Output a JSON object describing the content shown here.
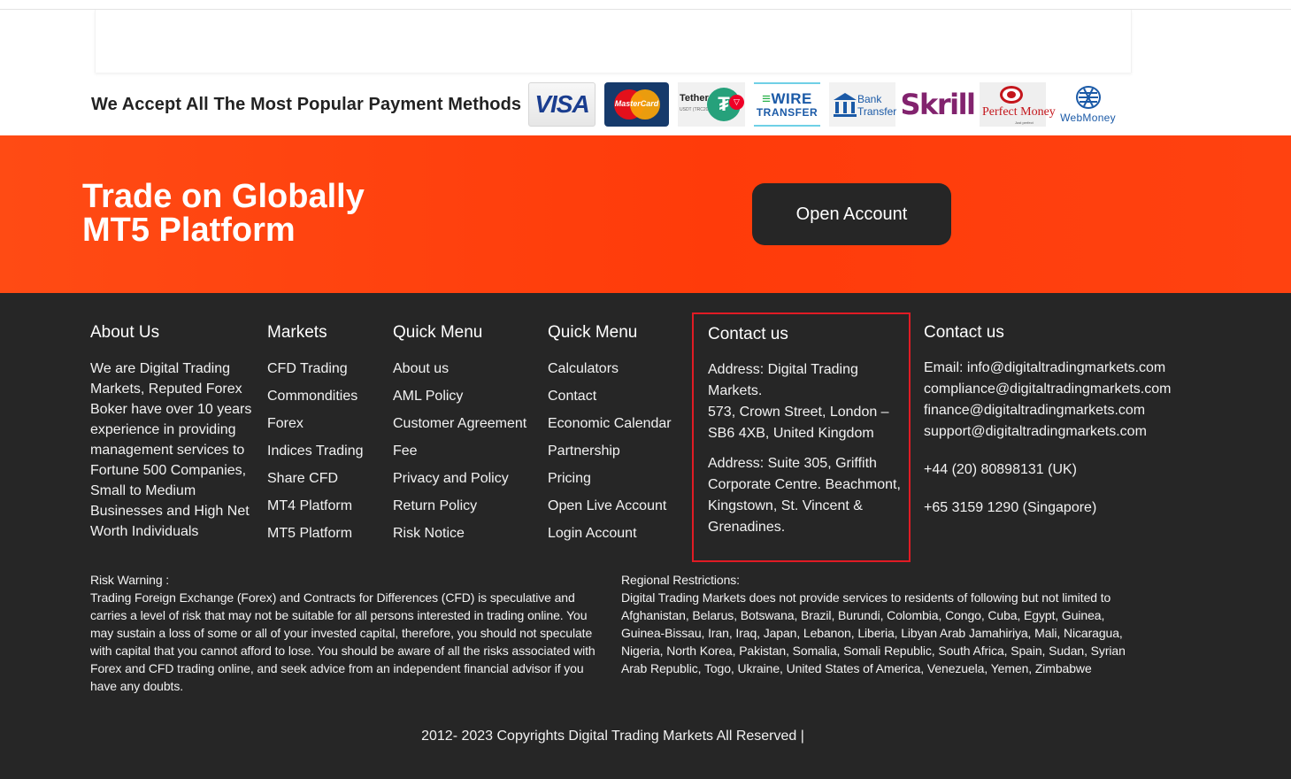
{
  "payments": {
    "title": "We Accept All The Most Popular Payment Methods",
    "logos": {
      "visa": "VISA",
      "mastercard": "MasterCard",
      "tether": "Tether",
      "tether_sub": "USDT (TRC20)",
      "wire_top": "WIRE",
      "wire_bottom": "TRANSFER",
      "bank_line1": "Bank",
      "bank_line2": "Transfer",
      "skrill": "Skrill",
      "perfect_money": "Perfect Money",
      "perfect_money_sub": "Just perfect",
      "webmoney": "WebMoney"
    }
  },
  "banner": {
    "title_line1": "Trade on Globally",
    "title_line2": "MT5 Platform",
    "button_label": "Open Account"
  },
  "footer": {
    "about": {
      "heading": "About Us",
      "text": "We are Digital Trading Markets, Reputed Forex Boker have over 10 years experience in providing management services to Fortune 500 Companies, Small to Medium Businesses and High Net Worth Individuals"
    },
    "markets": {
      "heading": "Markets",
      "items": [
        "CFD Trading",
        "Commondities",
        "Forex",
        "Indices Trading",
        "Share CFD",
        "MT4 Platform",
        "MT5 Platform"
      ]
    },
    "quick_menu_1": {
      "heading": "Quick Menu",
      "items": [
        "About us",
        "AML Policy",
        "Customer Agreement",
        "Fee",
        "Privacy and Policy",
        "Return Policy",
        "Risk Notice"
      ]
    },
    "quick_menu_2": {
      "heading": "Quick Menu",
      "items": [
        "Calculators",
        "Contact",
        "Economic Calendar",
        "Partnership",
        "Pricing",
        "Open Live Account",
        "Login Account"
      ]
    },
    "contact_1": {
      "heading": "Contact us",
      "address1": "Address: Digital Trading Markets.",
      "address1_line2": "573, Crown Street, London – SB6 4XB, United Kingdom",
      "address2": "Address: Suite 305, Griffith Corporate Centre. Beachmont, Kingstown, St. Vincent & Grenadines."
    },
    "contact_2": {
      "heading": "Contact us",
      "emails": [
        "Email: info@digitaltradingmarkets.com",
        "compliance@digitaltradingmarkets.com",
        "finance@digitaltradingmarkets.com",
        "support@digitaltradingmarkets.com"
      ],
      "phone_uk": "+44 (20) 80898131 (UK)",
      "phone_sg": "+65 3159 1290 (Singapore)"
    },
    "risk": {
      "heading": "Risk Warning :",
      "text": "Trading Foreign Exchange (Forex) and Contracts for Differences (CFD) is speculative and carries a level of risk that may not be suitable for all persons interested in trading online. You may sustain a loss of some or all of your invested capital, therefore, you should not speculate with capital that you cannot afford to lose. You should be aware of all the risks associated with Forex and CFD trading online, and seek advice from an independent financial advisor if you have any doubts."
    },
    "regional": {
      "heading": "Regional Restrictions:",
      "text": "Digital Trading Markets does not provide services to residents of following but not limited to Afghanistan, Belarus, Botswana, Brazil, Burundi, Colombia, Congo, Cuba, Egypt, Guinea, Guinea-Bissau, Iran, Iraq, Japan, Lebanon, Liberia, Libyan Arab Jamahiriya, Mali, Nicaragua, Nigeria, North Korea, Pakistan, Somalia, Somali Republic, South Africa, Spain, Sudan, Syrian Arab Republic, Togo, Ukraine, United States of America, Venezuela, Yemen, Zimbabwe"
    },
    "copyright": "2012- 2023 Copyrights Digital Trading Markets All Reserved |"
  },
  "colors": {
    "banner": "#ff4210",
    "footer_bg": "#262626",
    "button_bg": "#262626",
    "highlight_border": "#e01b24"
  }
}
